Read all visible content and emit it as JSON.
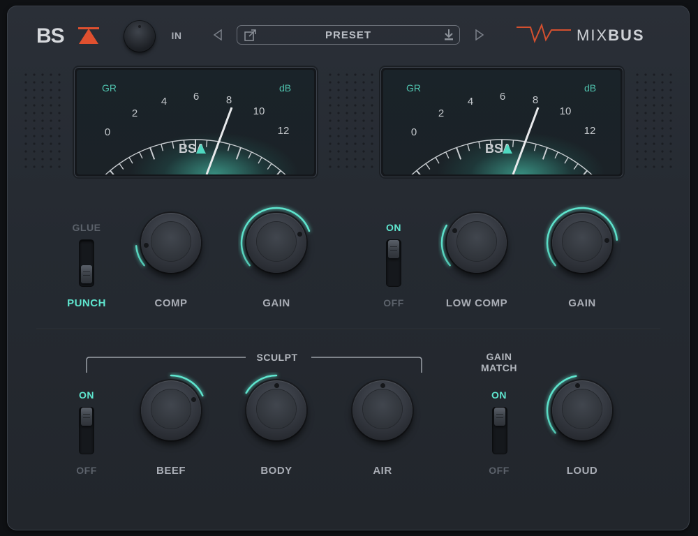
{
  "header": {
    "brand_logo_text": "BSA",
    "in_label": "IN",
    "preset_label": "PRESET",
    "product_name_light": "MIX",
    "product_name_bold": "BUS"
  },
  "meters": [
    {
      "left_label": "GR",
      "right_label": "dB",
      "scale": [
        "0",
        "2",
        "4",
        "6",
        "8",
        "10",
        "12"
      ],
      "logo": "BSA",
      "needle_value": 8.5
    },
    {
      "left_label": "GR",
      "right_label": "dB",
      "scale": [
        "0",
        "2",
        "4",
        "6",
        "8",
        "10",
        "12"
      ],
      "logo": "BSA",
      "needle_value": 8.5
    }
  ],
  "top_row": {
    "glue_switch": {
      "top_label": "GLUE",
      "bottom_label": "PUNCH"
    },
    "comp_label": "COMP",
    "gain1_label": "GAIN",
    "low_switch": {
      "top_label": "ON",
      "bottom_label": "OFF"
    },
    "low_comp_label": "LOW COMP",
    "gain2_label": "GAIN"
  },
  "bottom_row": {
    "sculpt_label": "SCULPT",
    "sculpt_switch": {
      "top_label": "ON",
      "bottom_label": "OFF"
    },
    "beef_label": "BEEF",
    "body_label": "BODY",
    "air_label": "AIR",
    "gain_match_line1": "GAIN",
    "gain_match_line2": "MATCH",
    "gain_match_switch": {
      "top_label": "ON",
      "bottom_label": "OFF"
    },
    "loud_label": "LOUD"
  },
  "colors": {
    "accent": "#5fe6cf",
    "brand_red": "#e0502f",
    "panel": "#262a31"
  }
}
